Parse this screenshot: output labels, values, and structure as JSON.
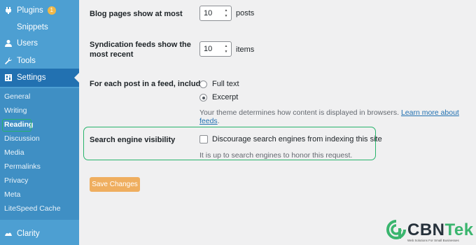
{
  "sidebar": {
    "plugins": {
      "label": "Plugins",
      "badge": "1",
      "icon": "plugin-icon"
    },
    "snippets": {
      "label": "Snippets"
    },
    "users": {
      "label": "Users",
      "icon": "users-icon"
    },
    "tools": {
      "label": "Tools",
      "icon": "wrench-icon"
    },
    "settings": {
      "label": "Settings",
      "icon": "settings-icon"
    },
    "submenu": [
      "General",
      "Writing",
      "Reading",
      "Discussion",
      "Media",
      "Permalinks",
      "Privacy",
      "Meta",
      "LiteSpeed Cache"
    ],
    "current_submenu": "Reading",
    "clarity": {
      "label": "Clarity",
      "icon": "clarity-icon"
    }
  },
  "settings": {
    "blog_pages": {
      "label": "Blog pages show at most",
      "value": "10",
      "unit": "posts"
    },
    "syndication": {
      "label_line1": "Syndication feeds show the",
      "label_line2": "most recent",
      "value": "10",
      "unit": "items"
    },
    "feed_content": {
      "label": "For each post in a feed, include",
      "options": [
        "Full text",
        "Excerpt"
      ],
      "selected": "Excerpt",
      "description": "Your theme determines how content is displayed in browsers.",
      "link_text": "Learn more about feeds",
      "description_end": "."
    },
    "search_visibility": {
      "label": "Search engine visibility",
      "checkbox_label": "Discourage search engines from indexing this site",
      "checked": false,
      "description": "It is up to search engines to honor this request."
    },
    "save_label": "Save Changes"
  },
  "logo": {
    "brand_primary": "CBN",
    "brand_secondary": "Tek",
    "tagline": "Web Solutions For Small Businesses"
  },
  "colors": {
    "sidebar": "#4d9fd2",
    "settings_active": "#2271b1",
    "highlight": "#27b36b",
    "save_button": "#efae5f",
    "link": "#2271b1"
  }
}
